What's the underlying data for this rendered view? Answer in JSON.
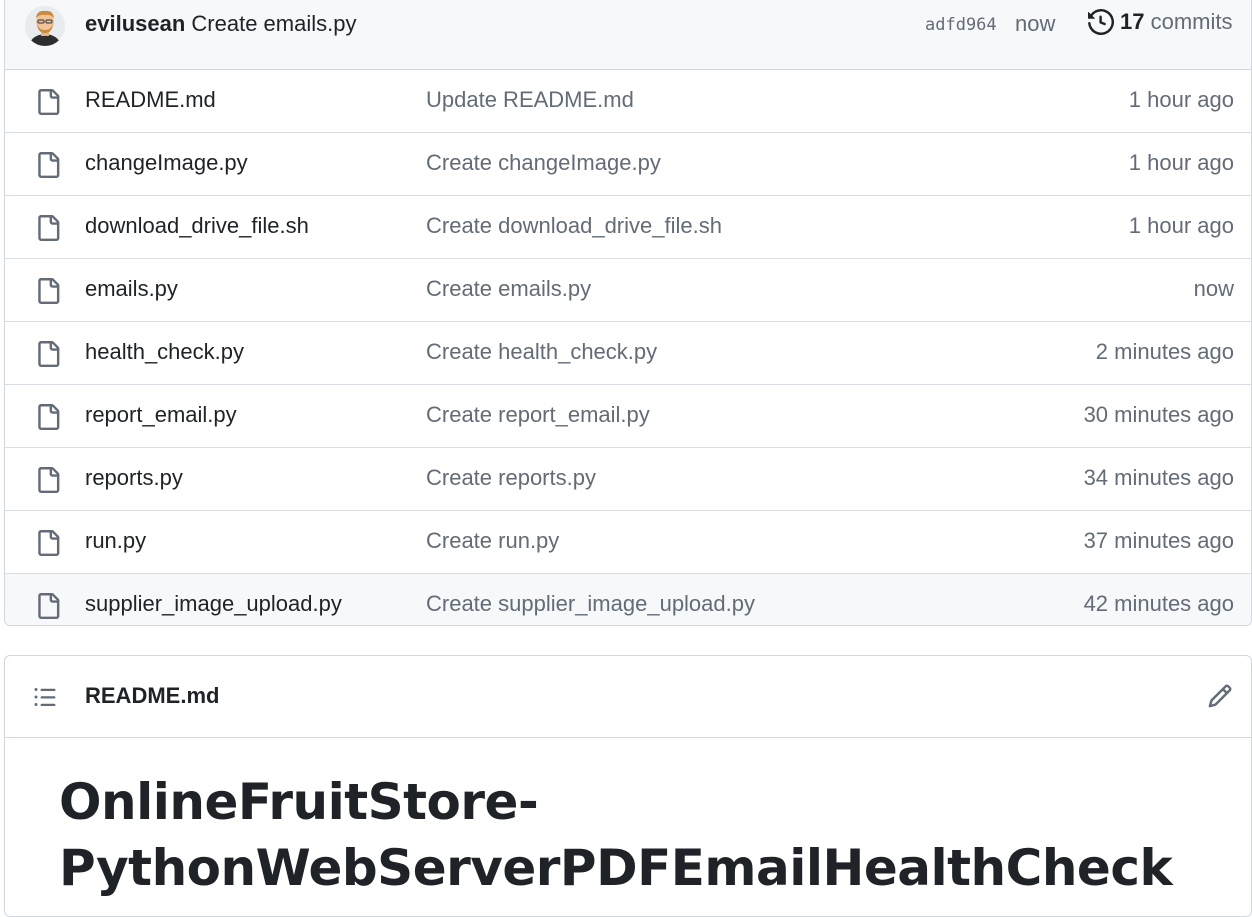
{
  "latest_commit": {
    "author": "evilusean",
    "message": "Create emails.py",
    "hash": "adfd964",
    "time": "now",
    "commit_count": "17",
    "commits_label": "commits"
  },
  "files": [
    {
      "name": "README.md",
      "commit": "Update README.md",
      "age": "1 hour ago"
    },
    {
      "name": "changeImage.py",
      "commit": "Create changeImage.py",
      "age": "1 hour ago"
    },
    {
      "name": "download_drive_file.sh",
      "commit": "Create download_drive_file.sh",
      "age": "1 hour ago"
    },
    {
      "name": "emails.py",
      "commit": "Create emails.py",
      "age": "now"
    },
    {
      "name": "health_check.py",
      "commit": "Create health_check.py",
      "age": "2 minutes ago"
    },
    {
      "name": "report_email.py",
      "commit": "Create report_email.py",
      "age": "30 minutes ago"
    },
    {
      "name": "reports.py",
      "commit": "Create reports.py",
      "age": "34 minutes ago"
    },
    {
      "name": "run.py",
      "commit": "Create run.py",
      "age": "37 minutes ago"
    },
    {
      "name": "supplier_image_upload.py",
      "commit": "Create supplier_image_upload.py",
      "age": "42 minutes ago"
    }
  ],
  "readme": {
    "file_label": "README.md",
    "heading_line1": "OnlineFruitStore-",
    "heading_line2": "PythonWebServerPDFEmailHealthCheck"
  },
  "icons": {
    "file": "file-icon",
    "history": "history-icon",
    "toc": "list-unordered-icon",
    "edit": "pencil-icon"
  },
  "colors": {
    "text_primary": "#1f2328",
    "text_muted": "#636c76",
    "border": "#d0d7de",
    "header_bg": "#f6f8fa"
  }
}
